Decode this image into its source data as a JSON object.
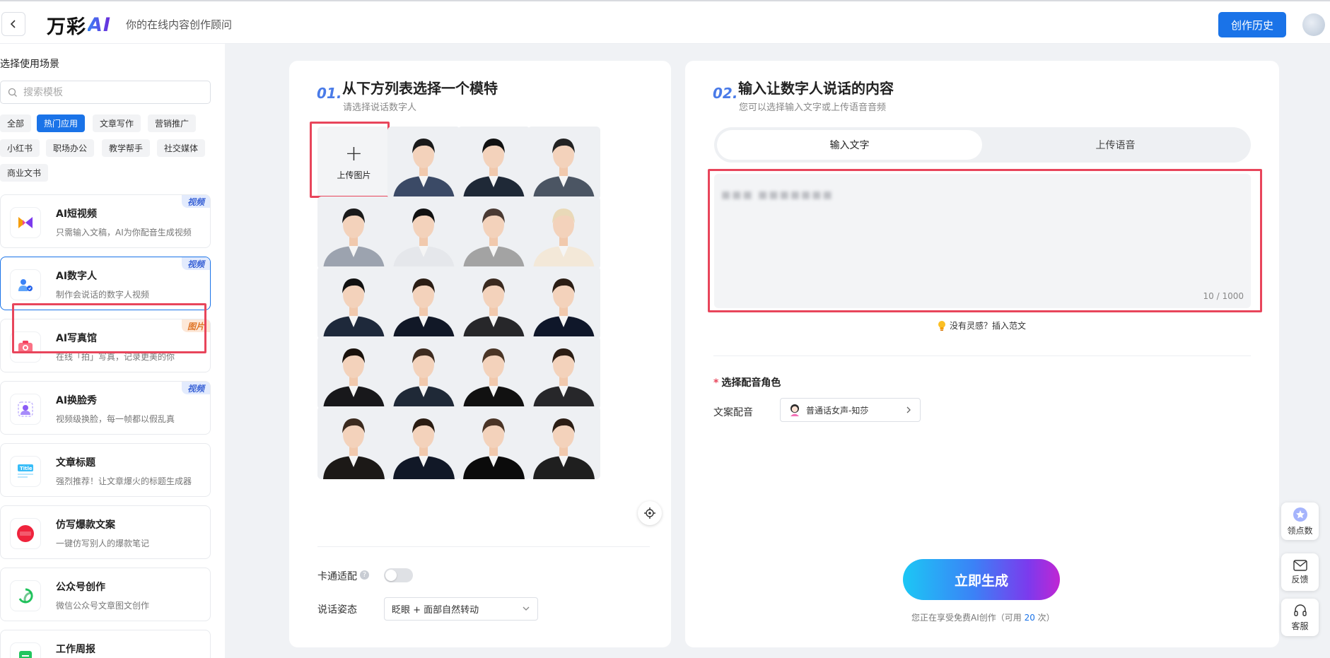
{
  "header": {
    "logo_text": "万彩",
    "logo_ai": "AI",
    "tagline": "你的在线内容创作顾问",
    "history_button": "创作历史"
  },
  "sidebar": {
    "title": "选择使用场景",
    "search_placeholder": "搜索模板",
    "tags": [
      "全部",
      "热门应用",
      "文章写作",
      "营销推广",
      "小红书",
      "职场办公",
      "教学帮手",
      "社交媒体",
      "商业文书"
    ],
    "active_tag": "热门应用",
    "cards": [
      {
        "title": "AI短视频",
        "desc": "只需输入文稿，AI为你配音生成视频",
        "badge": "视频",
        "icon": "video-bowtie-icon"
      },
      {
        "title": "AI数字人",
        "desc": "制作会说话的数字人视频",
        "badge": "视频",
        "icon": "digital-human-icon"
      },
      {
        "title": "AI写真馆",
        "desc": "在线「拍」写真，记录更美的你",
        "badge": "图片",
        "icon": "camera-icon"
      },
      {
        "title": "AI换脸秀",
        "desc": "视频级换脸，每一帧都以假乱真",
        "badge": "视频",
        "icon": "face-swap-icon"
      },
      {
        "title": "文章标题",
        "desc": "强烈推荐！让文章爆火的标题生成器",
        "badge": "",
        "icon": "title-doc-icon"
      },
      {
        "title": "仿写爆款文案",
        "desc": "一键仿写别人的爆款笔记",
        "badge": "",
        "icon": "xiaohongshu-icon"
      },
      {
        "title": "公众号创作",
        "desc": "微信公众号文章图文创作",
        "badge": "",
        "icon": "wechat-official-icon"
      },
      {
        "title": "工作周报",
        "desc": "",
        "badge": "",
        "icon": "weekly-report-icon"
      }
    ]
  },
  "step1": {
    "num": "01.",
    "title": "从下方列表选择一个模特",
    "subtitle": "请选择说话数字人",
    "upload_label": "上传图片",
    "cartoon_label": "卡通适配",
    "pose_label": "说话姿态",
    "pose_value": "眨眼 + 面部自然转动"
  },
  "step2": {
    "num": "02.",
    "title": "输入让数字人说话的内容",
    "subtitle": "您可以选择输入文字或上传语音音频",
    "tab_text": "输入文字",
    "tab_audio": "上传语音",
    "textarea_content": "■■■ ■■■■■■■",
    "counter": "10 / 1000",
    "inspire": "没有灵感？插入范文",
    "voice_section": "选择配音角色",
    "voice_label": "文案配音",
    "voice_value": "普通话女声-知莎",
    "generate_button": "立即生成",
    "free_note_prefix": "您正在享受免费AI创作（可用 ",
    "free_count": "20",
    "free_note_suffix": " 次）"
  },
  "floating": {
    "points": "领点数",
    "feedback": "反馈",
    "service": "客服"
  },
  "colors": {
    "primary": "#1a73e8",
    "highlight": "#e8455b",
    "step_num": "#4a7be8"
  }
}
